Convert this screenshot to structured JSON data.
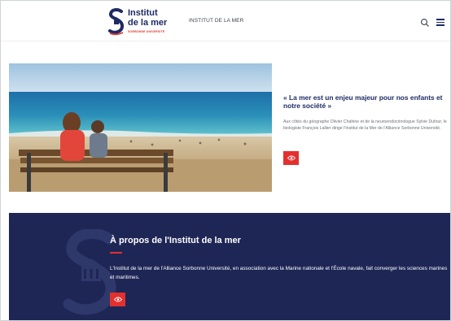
{
  "header": {
    "logo": {
      "title_line1": "Institut",
      "title_line2": "de la mer",
      "subtitle": "SORBONNE UNIVERSITÉ"
    },
    "nav_label": "INSTITUT DE LA MER",
    "search_icon": "search-icon",
    "menu_icon": "hamburger-menu-icon"
  },
  "feature": {
    "title": "« La mer est un enjeu majeur pour nos enfants et notre société »",
    "text": "Aux côtés du géographe Olivier Chahine et de la neuroendocrinologue Sylvie Dufour, le biologiste François Lallier dirige l'Institut de la Mer de l'Alliance Sorbonne Université.",
    "button_icon": "eye-icon"
  },
  "about": {
    "title": "À propos de l'Institut de la mer",
    "text": "L'Institut de la mer de l'Alliance Sorbonne Université, en association avec la Marine nationale et l'École navale, fait converger les sciences marines et maritimes.",
    "button_icon": "eye-icon"
  },
  "colors": {
    "navy": "#1d2b64",
    "band": "#1e2656",
    "accent_red": "#e3302f"
  }
}
